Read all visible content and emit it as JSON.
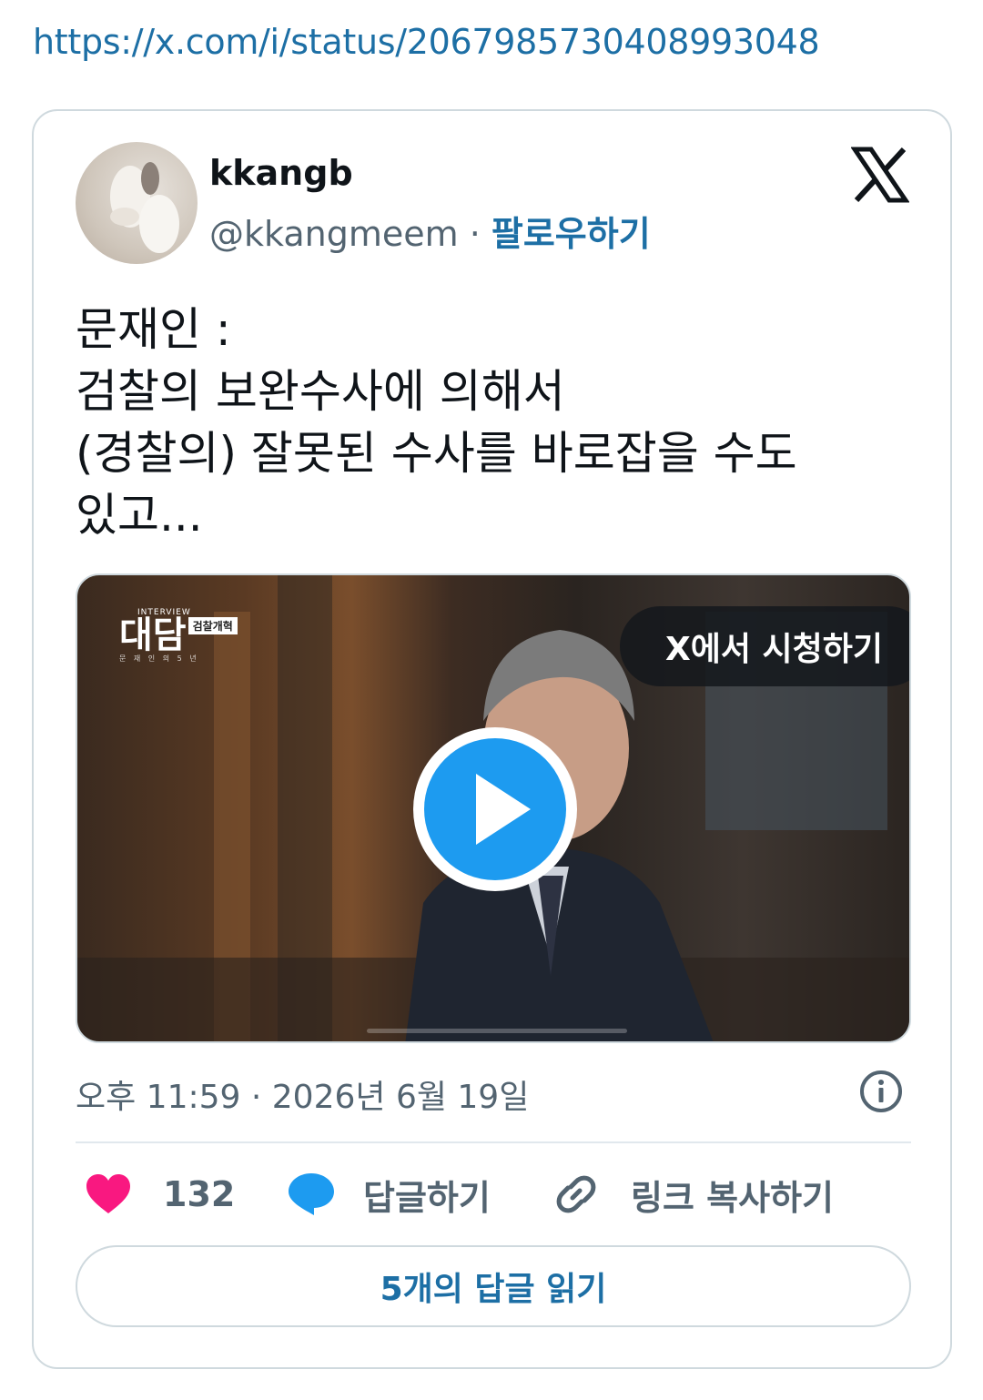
{
  "url": "https://x.com/i/status/2067985730408993048",
  "tweet": {
    "display_name": "kkangb",
    "handle": "@kkangmeem",
    "separator": " · ",
    "follow_label": "팔로우하기",
    "text_lines": [
      "문재인 :",
      "검찰의 보완수사에 의해서",
      "(경찰의) 잘못된 수사를 바로잡을 수도",
      "있고..."
    ],
    "timestamp": "오후 11:59 · 2026년 6월 19일"
  },
  "media": {
    "watch_on_x_label": "X에서 시청하기",
    "show_logo_small": "INTERVIEW",
    "show_logo_title": "대담",
    "show_logo_tag": "검찰개혁",
    "show_logo_sub": "문 재 인 의 5 년"
  },
  "actions": {
    "like_count": "132",
    "reply_label": "답글하기",
    "copy_link_label": "링크 복사하기",
    "read_replies_label": "5개의 답글 읽기"
  },
  "colors": {
    "link": "#1d6fa5",
    "like": "#f91880",
    "reply": "#1d9bf0",
    "play": "#1d9bf0",
    "muted": "#536471"
  }
}
